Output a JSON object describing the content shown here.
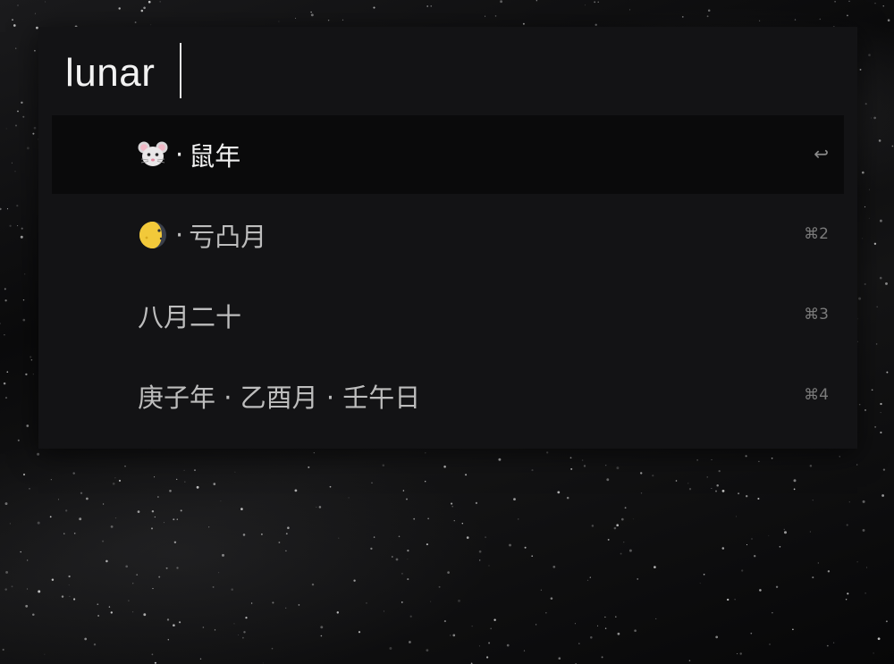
{
  "search": {
    "query": "lunar"
  },
  "results": [
    {
      "icon": "rat-face-icon",
      "separator": "·",
      "label": "鼠年",
      "shortcut": "↩",
      "selected": true
    },
    {
      "icon": "waxing-gibbous-moon-icon",
      "separator": "·",
      "label": "亏凸月",
      "shortcut": "⌘2",
      "selected": false
    },
    {
      "icon": "",
      "separator": "",
      "label": "八月二十",
      "shortcut": "⌘3",
      "selected": false
    },
    {
      "icon": "",
      "separator": "",
      "label": "庚子年 · 乙酉月 · 壬午日",
      "shortcut": "⌘4",
      "selected": false
    }
  ],
  "colors": {
    "panel": "#131315",
    "selected_row": "#0a0a0b",
    "text_primary": "#f0f0f0",
    "text_secondary": "#bdbdbd",
    "shortcut": "#7a7a7a"
  }
}
